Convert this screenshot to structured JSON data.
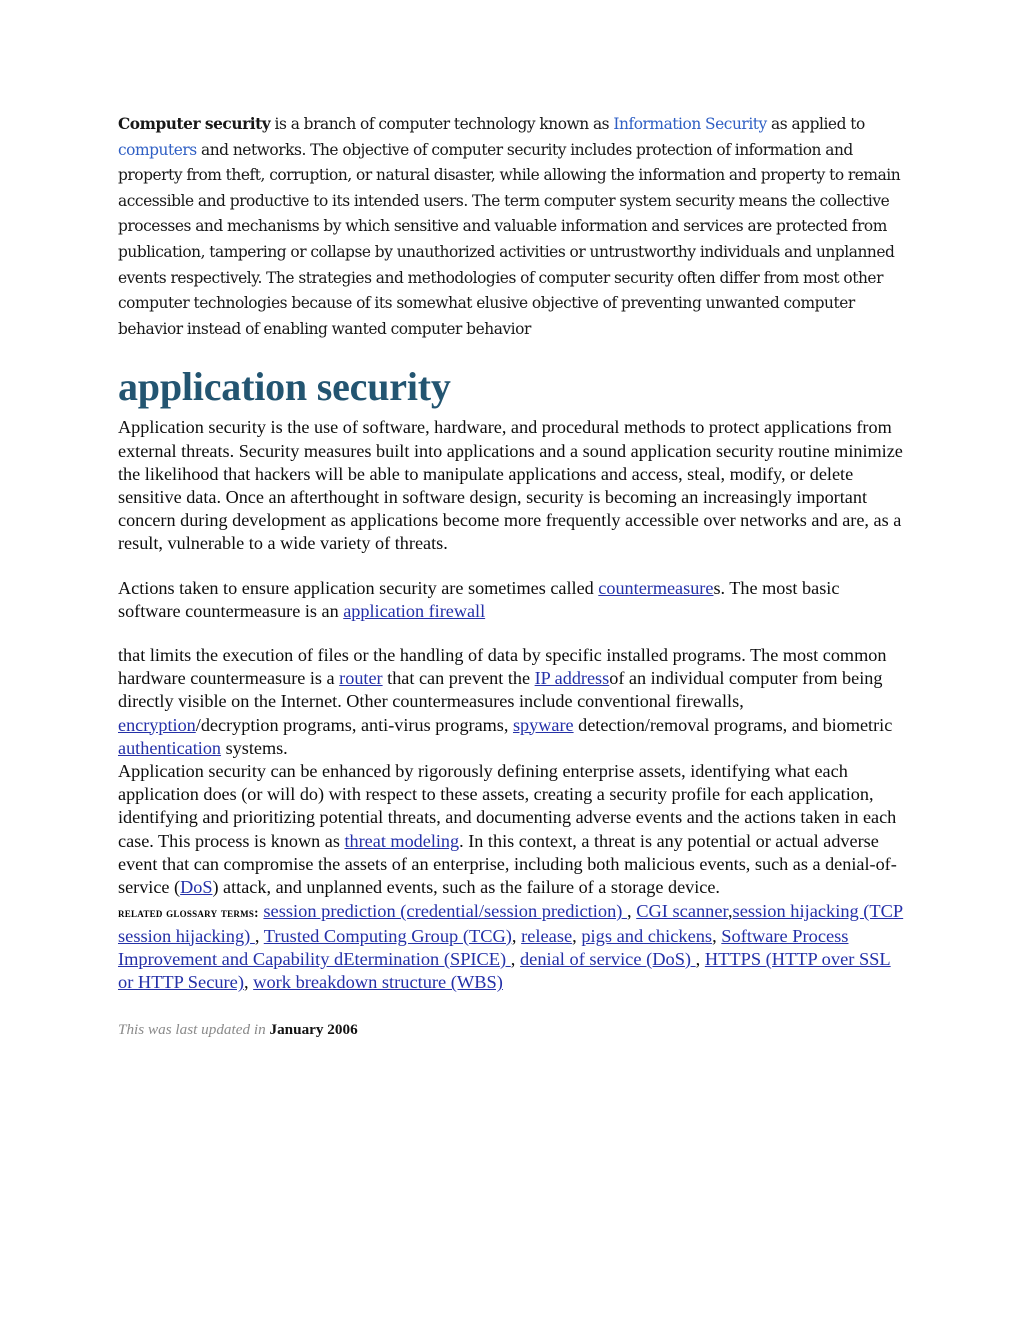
{
  "document": {
    "intro": {
      "lead_bold": "Computer security",
      "t1": " is a branch of computer technology known as ",
      "link1": "Information Security",
      "t2": " as applied to ",
      "link2": "computers",
      "t3": " and networks. The objective of computer security includes protection of information and property from theft, corruption, or natural disaster, while allowing the information and property to remain accessible and productive to its intended users. The term computer system security means the collective processes and mechanisms by which sensitive and valuable information and services are protected from publication, tampering or collapse by unauthorized activities or untrustworthy individuals and unplanned events respectively. The strategies and methodologies of computer security often differ from most other computer technologies because of its somewhat elusive objective of preventing unwanted computer behavior instead of enabling wanted computer behavior"
    },
    "heading": "application security",
    "para1": "Application security is the use of software, hardware, and procedural methods to protect applications from external threats. Security measures built into applications and a sound application security routine minimize the likelihood that hackers will be able to manipulate applications and access, steal, modify, or delete sensitive data. Once an afterthought in software design, security is becoming an increasingly important concern during development as applications become more frequently accessible over networks and are, as a result, vulnerable to a wide variety of threats.",
    "para2": {
      "t1": "Actions taken to ensure application security are sometimes called ",
      "link1": "countermeasure",
      "t2": "s. The most basic software countermeasure is an ",
      "link2": "application firewall"
    },
    "para3": {
      "t1": "that limits the execution of files or the handling of data by specific installed programs. The most common hardware countermeasure is a ",
      "link1": "router",
      "t2": " that can prevent the ",
      "link2": "IP address",
      "t3": "of an individual computer from being directly visible on the Internet. Other countermeasures include conventional firewalls, ",
      "link3": "encryption",
      "t4": "/decryption programs, anti-virus programs, ",
      "link4": "spyware",
      "t5": " detection/removal programs, and biometric ",
      "link5": "authentication",
      "t6": " systems."
    },
    "para4": {
      "t1": "Application security can be enhanced by rigorously defining enterprise assets, identifying what each application does (or will do) with respect to these assets, creating a security profile for each application, identifying and prioritizing potential threats, and documenting adverse events and the actions taken in each case. This process is known as ",
      "link1": "threat modeling",
      "t2": ". In this context, a threat is any potential or actual adverse event that can compromise the assets of an enterprise, including both malicious events, such as a denial-of-service (",
      "link2": "DoS",
      "t3": ") attack, and unplanned events, such as the failure of a storage device."
    },
    "related": {
      "label": "Related Glossary Terms:",
      "terms": [
        {
          "text": "session prediction (credential/session prediction) ",
          "sep": ", "
        },
        {
          "text": "CGI scanner",
          "sep": ","
        },
        {
          "text": "session hijacking (TCP session hijacking) ",
          "sep": ", "
        },
        {
          "text": "Trusted Computing Group (TCG)",
          "sep": ", "
        },
        {
          "text": "release",
          "sep": ", "
        },
        {
          "text": "pigs and chickens",
          "sep": ", "
        },
        {
          "text": "Software Process Improvement and Capability dEtermination (SPICE) ",
          "sep": ", "
        },
        {
          "text": "denial of service (DoS) ",
          "sep": ", "
        },
        {
          "text": "HTTPS (HTTP over SSL or HTTP Secure)",
          "sep": ", "
        },
        {
          "text": "work breakdown structure (WBS)",
          "sep": ""
        }
      ]
    },
    "footer": {
      "label": "This was last updated in ",
      "value": "January 2006"
    },
    "colors": {
      "heading": "#235571",
      "intro_link": "#2F5FC4",
      "body_link": "#2430A8",
      "body_text": "#0d0d0d",
      "muted": "#8a8a8a",
      "background": "#ffffff"
    }
  }
}
